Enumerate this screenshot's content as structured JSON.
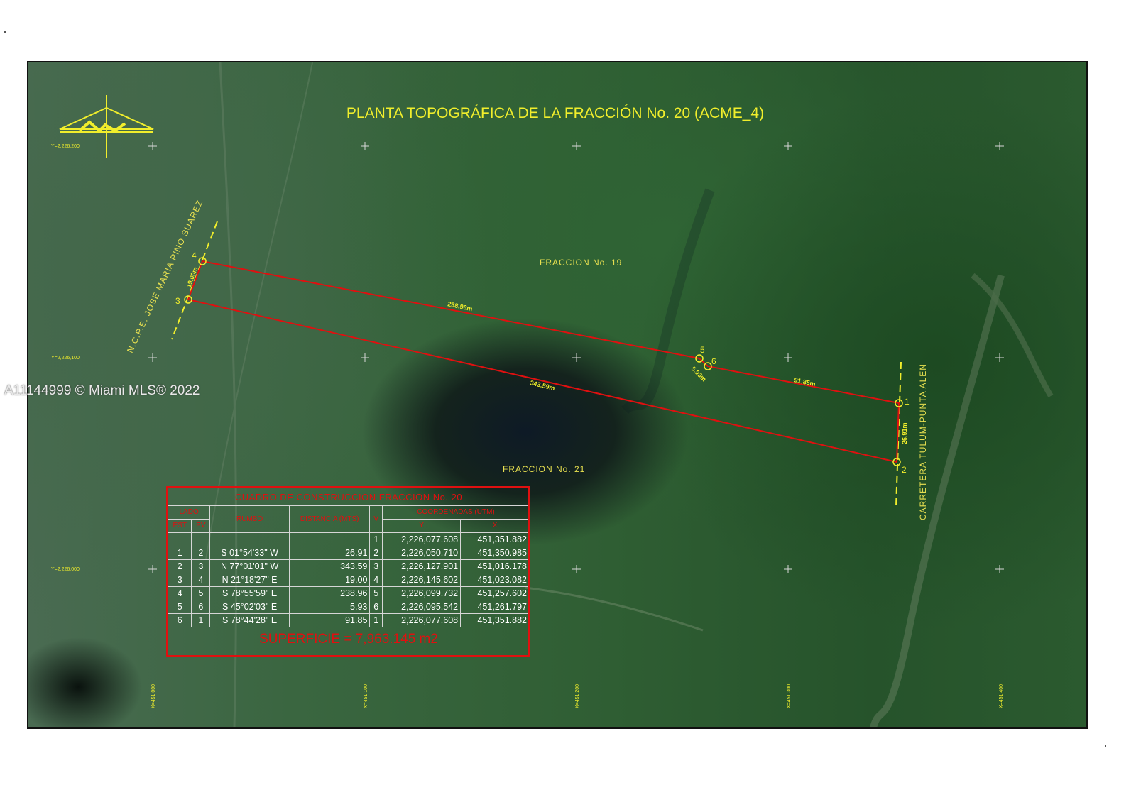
{
  "title": "PLANTA TOPOGRÁFICA DE LA FRACCIÓN No. 20 (ACME_4)",
  "watermark": "A11144999 © Miami MLS® 2022",
  "labels": {
    "fraccion_19": "FRACCION  No.  19",
    "fraccion_21": "FRACCION  No.  21",
    "road_left": "N.C.P.E.  JOSE  MARIA  PINO  SUAREZ",
    "road_right": "CARRETERA  TULUM-PUNTA  ALEN"
  },
  "grid_labels": {
    "y_top": "Y=2,226,200",
    "y_mid": "Y=2,226,100",
    "y_bot": "Y=2,226,000",
    "x1": "X=451,000",
    "x2": "X=451,100",
    "x3": "X=451,200",
    "x4": "X=451,300",
    "x5": "X=451,400"
  },
  "segments": {
    "s45": "238.96m",
    "s32": "343.59m",
    "s34": "19.00m",
    "s56": "5.93m",
    "s61": "91.85m",
    "s12": "26.91m"
  },
  "vertices": [
    "1",
    "2",
    "3",
    "4",
    "5",
    "6"
  ],
  "colors": {
    "title": "#f1ee2c",
    "boundary": "#e01010",
    "label_yellow": "#e8e050"
  },
  "table": {
    "title": "CUADRO DE CONSTRUCCION FRACCION No. 20",
    "h_lado": "LADO",
    "h_est": "EST",
    "h_pv": "PV",
    "h_rumbo": "RUMBO",
    "h_distancia": "DISTANCIA (MTS)",
    "h_v": "V",
    "h_coord": "COORDENADAS  (UTM)",
    "h_y": "Y",
    "h_x": "X",
    "first_row": {
      "v": "1",
      "y": "2,226,077.608",
      "x": "451,351.882"
    },
    "rows": [
      {
        "est": "1",
        "pv": "2",
        "rumbo": "S 01°54'33\" W",
        "dist": "26.91",
        "v": "2",
        "y": "2,226,050.710",
        "x": "451,350.985"
      },
      {
        "est": "2",
        "pv": "3",
        "rumbo": "N 77°01'01\" W",
        "dist": "343.59",
        "v": "3",
        "y": "2,226,127.901",
        "x": "451,016.178"
      },
      {
        "est": "3",
        "pv": "4",
        "rumbo": "N 21°18'27\" E",
        "dist": "19.00",
        "v": "4",
        "y": "2,226,145.602",
        "x": "451,023.082"
      },
      {
        "est": "4",
        "pv": "5",
        "rumbo": "S 78°55'59\" E",
        "dist": "238.96",
        "v": "5",
        "y": "2,226,099.732",
        "x": "451,257.602"
      },
      {
        "est": "5",
        "pv": "6",
        "rumbo": "S 45°02'03\" E",
        "dist": "5.93",
        "v": "6",
        "y": "2,226,095.542",
        "x": "451,261.797"
      },
      {
        "est": "6",
        "pv": "1",
        "rumbo": "S 78°44'28\" E",
        "dist": "91.85",
        "v": "1",
        "y": "2,226,077.608",
        "x": "451,351.882"
      }
    ],
    "superficie": "SUPERFICIE = 7,963.145 m2"
  }
}
